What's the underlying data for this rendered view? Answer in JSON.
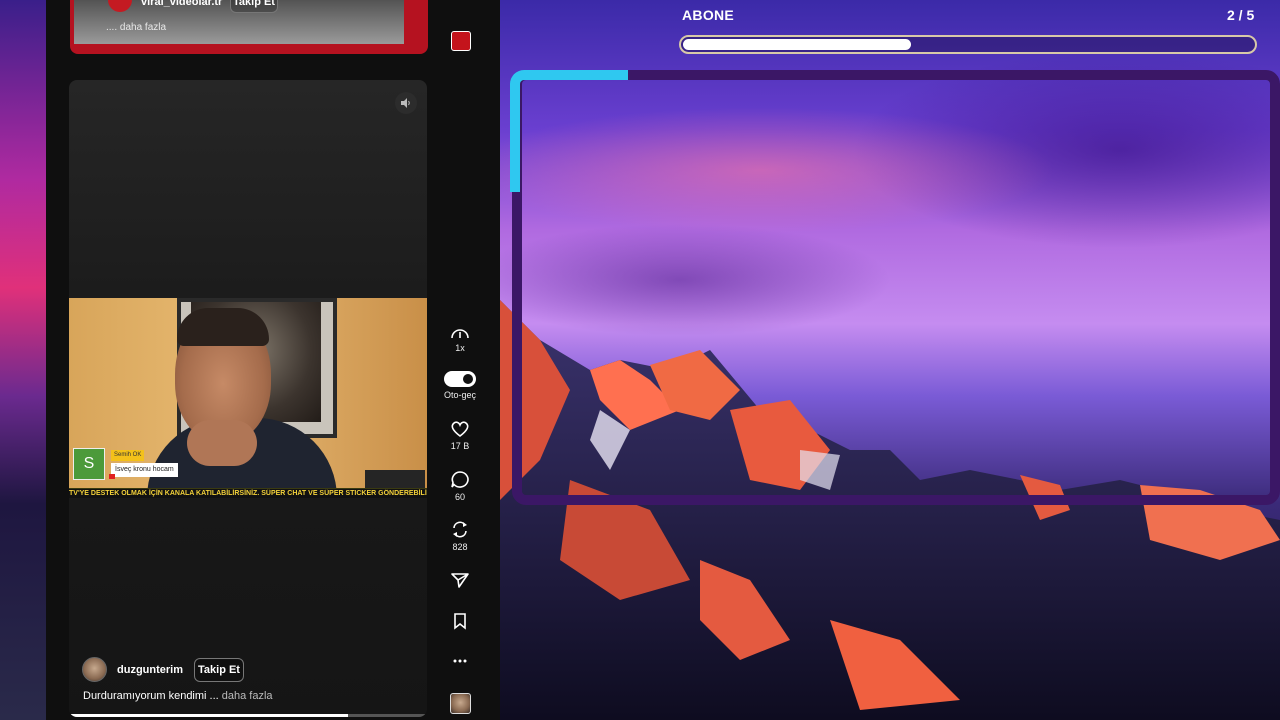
{
  "colors": {
    "accent_cyan": "#2fc8f0",
    "frame_purple": "#3b1766",
    "feed_bg": "#0f0f0f",
    "brand_red": "#c4141c"
  },
  "previous_post": {
    "username": "viral_videolar.tr",
    "follow_label": "Takip Et",
    "description": ".... daha fazla"
  },
  "current_post": {
    "name_tag_letter": "S",
    "name_tag_title": "Semih OK",
    "name_tag_subtitle": "İsveç kronu hocam",
    "ticker": "TV'YE DESTEK OLMAK İÇİN KANALA KATILABİLİRSİNİZ. SÜPER CHAT VE SÜPER STICKER GÖNDEREBİLİR",
    "username": "duzgunterim",
    "follow_label": "Takip Et",
    "description": "Durduramıyorum kendimi ...",
    "more_label": "daha fazla",
    "playback_progress": 0.78
  },
  "actions": {
    "speed_label": "1x",
    "autoplay_label": "Oto-geç",
    "likes": "17 B",
    "comments": "60",
    "reposts": "828",
    "more_icon": "more-horizontal-icon"
  },
  "overlay": {
    "label": "ABONE",
    "count": "2 / 5",
    "progress": 0.4
  }
}
